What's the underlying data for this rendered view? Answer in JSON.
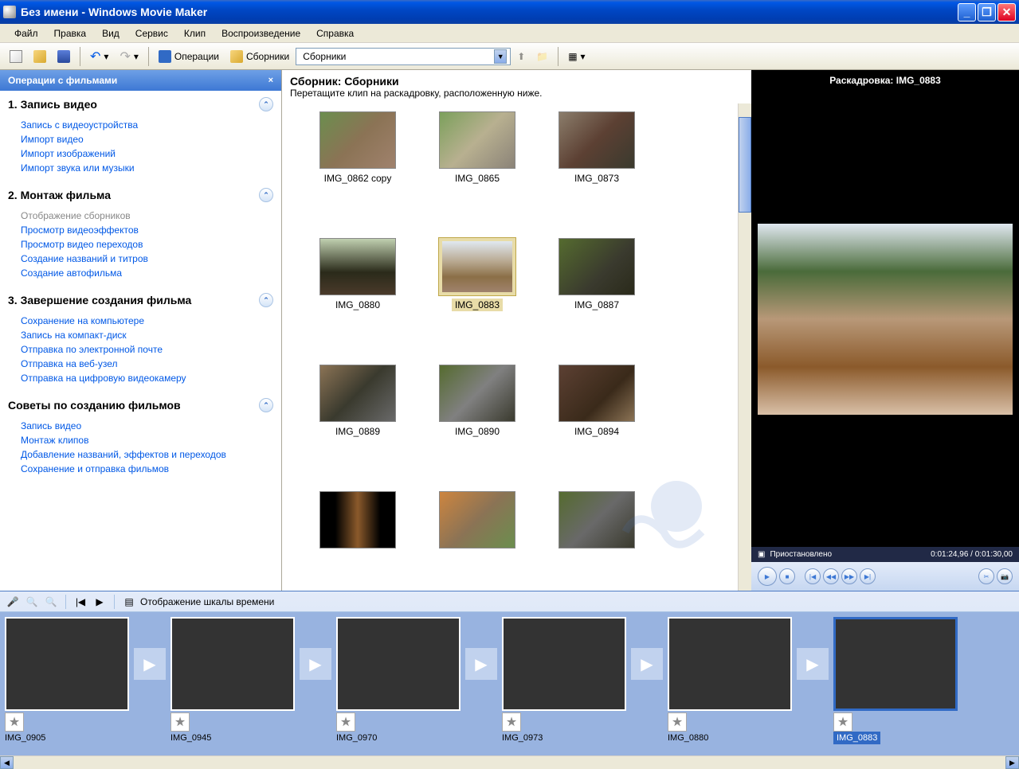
{
  "titlebar": {
    "title": "Без имени - Windows Movie Maker"
  },
  "menu": {
    "file": "Файл",
    "edit": "Правка",
    "view": "Вид",
    "service": "Сервис",
    "clip": "Клип",
    "play": "Воспроизведение",
    "help": "Справка"
  },
  "toolbar": {
    "ops": "Операции",
    "colls": "Сборники",
    "combo": "Сборники"
  },
  "tasks": {
    "header": "Операции с фильмами",
    "s1": {
      "title": "1. Запись видео",
      "links": [
        "Запись с видеоустройства",
        "Импорт видео",
        "Импорт изображений",
        "Импорт звука или музыки"
      ]
    },
    "s2": {
      "title": "2. Монтаж фильма",
      "links": [
        "Отображение сборников",
        "Просмотр видеоэффектов",
        "Просмотр видео переходов",
        "Создание названий и титров",
        "Создание автофильма"
      ]
    },
    "s3": {
      "title": "3. Завершение создания фильма",
      "links": [
        "Сохранение на компьютере",
        "Запись на компакт-диск",
        "Отправка по электронной почте",
        "Отправка на веб-узел",
        "Отправка на цифровую видеокамеру"
      ]
    },
    "s4": {
      "title": "Советы по созданию фильмов",
      "links": [
        "Запись видео",
        "Монтаж клипов",
        "Добавление названий, эффектов и переходов",
        "Сохранение и отправка фильмов"
      ]
    }
  },
  "collection": {
    "title": "Сборник: Сборники",
    "hint": "Перетащите клип на раскадровку, расположенную ниже.",
    "items": [
      {
        "label": "IMG_0862 copy",
        "img": "img-deer",
        "selected": false
      },
      {
        "label": "IMG_0865",
        "img": "img-park",
        "selected": false
      },
      {
        "label": "IMG_0873",
        "img": "img-goat",
        "selected": false
      },
      {
        "label": "IMG_0880",
        "img": "img-eagle1",
        "selected": false
      },
      {
        "label": "IMG_0883",
        "img": "img-eagle2",
        "selected": true
      },
      {
        "label": "IMG_0887",
        "img": "img-monkey",
        "selected": false
      },
      {
        "label": "IMG_0889",
        "img": "img-raccoon1",
        "selected": false
      },
      {
        "label": "IMG_0890",
        "img": "img-raccoon2",
        "selected": false
      },
      {
        "label": "IMG_0894",
        "img": "img-bear",
        "selected": false
      },
      {
        "label": "",
        "img": "img-fox1",
        "selected": false
      },
      {
        "label": "",
        "img": "img-fox2",
        "selected": false
      },
      {
        "label": "",
        "img": "img-wolf",
        "selected": false
      }
    ]
  },
  "preview": {
    "title": "Раскадровка: IMG_0883",
    "status": "Приостановлено",
    "time": "0:01:24,96 / 0:01:30,00"
  },
  "timeline": {
    "toolbar_label": "Отображение шкалы времени",
    "clips": [
      {
        "label": "IMG_0905",
        "img": "img-fox3",
        "selected": false
      },
      {
        "label": "IMG_0945",
        "img": "img-foxes",
        "selected": false
      },
      {
        "label": "IMG_0970",
        "img": "img-cat",
        "selected": false
      },
      {
        "label": "IMG_0973",
        "img": "img-squirrel",
        "selected": false
      },
      {
        "label": "IMG_0880",
        "img": "img-eagle1",
        "selected": false
      },
      {
        "label": "IMG_0883",
        "img": "img-eagle-on-roof",
        "selected": true
      }
    ]
  }
}
